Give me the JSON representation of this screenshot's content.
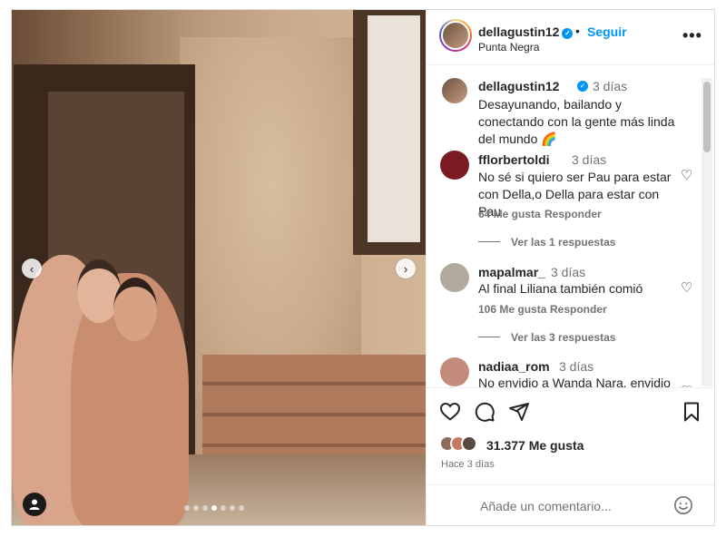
{
  "post": {
    "username": "dellagustin12",
    "follow_label": "Seguir",
    "separator": "•",
    "location": "Punta Negra",
    "more_label": "•••",
    "caption": {
      "username": "dellagustin12",
      "time": "3 días",
      "text": "Desayunando, bailando y conectando con la gente más linda del mundo 🌈"
    },
    "carousel": {
      "dots": 7,
      "active_index": 3
    }
  },
  "comments": [
    {
      "username": "fflorbertoldi",
      "time": "3 días",
      "text": "No sé si quiero ser Pau para estar con Della,o Della para estar con Pau",
      "likes": "64 Me gusta",
      "reply_label": "Responder",
      "view_replies": "Ver las 1 respuestas",
      "avatar_color": "#7a1b24"
    },
    {
      "username": "mapalmar_",
      "time": "3 días",
      "text": "Al final Liliana también comió",
      "likes": "106 Me gusta",
      "reply_label": "Responder",
      "view_replies": "Ver las 3 respuestas",
      "avatar_color": "#b0a99c"
    },
    {
      "username": "nadiaa_rom",
      "time": "3 días",
      "text": "No envidio a Wanda Nara, envidio a Pau Baldini",
      "avatar_color": "#c48b7a"
    }
  ],
  "actions": {
    "likes_count": "31.377 Me gusta",
    "posted_ago": "Hace 3 días",
    "comment_placeholder": "Añade un comentario...",
    "liker_colors": [
      "#8c6d5a",
      "#c47a62",
      "#5a4a40"
    ]
  },
  "icons": {
    "prev": "‹",
    "next": "›",
    "like": "♡"
  }
}
